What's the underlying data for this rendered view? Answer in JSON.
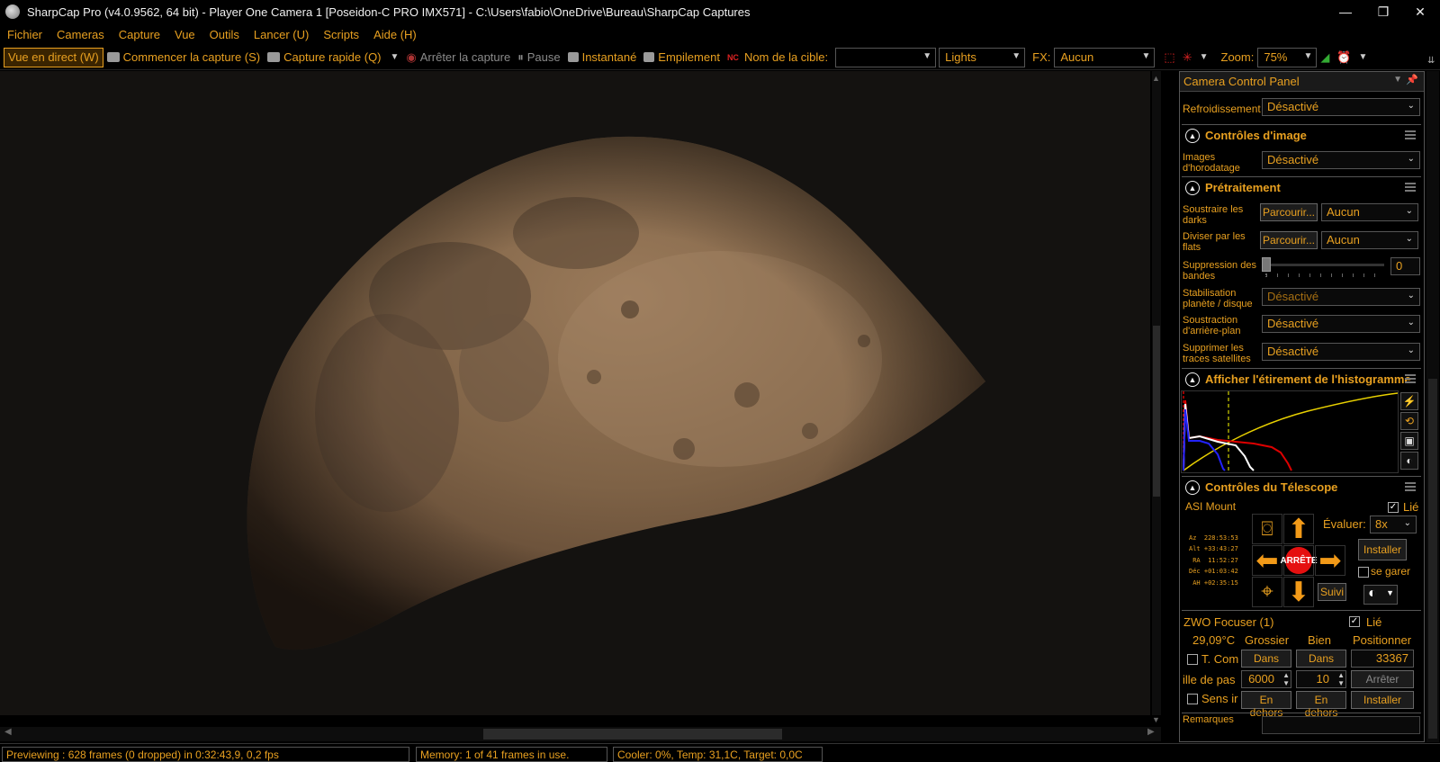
{
  "window": {
    "title": "SharpCap Pro (v4.0.9562, 64 bit) - Player One Camera 1 [Poseidon-C PRO IMX571] - C:\\Users\\fabio\\OneDrive\\Bureau\\SharpCap Captures",
    "minimize": "—",
    "maximize": "❐",
    "close": "✕"
  },
  "menu": [
    "Fichier",
    "Cameras",
    "Capture",
    "Vue",
    "Outils",
    "Lancer (U)",
    "Scripts",
    "Aide (H)"
  ],
  "toolbar": {
    "live": "Vue en direct (W)",
    "start_capture": "Commencer la capture (S)",
    "quick_capture": "Capture rapide (Q)",
    "stop_capture": "Arrêter la capture",
    "pause": "Pause",
    "snapshot": "Instantané",
    "stack": "Empilement",
    "target_label": "Nom de la cible:",
    "target_value": "",
    "frame_type": "Lights",
    "fx_label": "FX:",
    "fx_value": "Aucun",
    "zoom_label": "Zoom:",
    "zoom_value": "75%"
  },
  "panel": {
    "title": "Camera Control Panel",
    "cooling_label": "Refroidissement",
    "cooling_value": "Désactivé",
    "image_controls": {
      "title": "Contrôles d'image",
      "timestamp_label": "Images d'horodatage",
      "timestamp_value": "Désactivé"
    },
    "preprocessing": {
      "title": "Prétraitement",
      "darks_label": "Soustraire les darks",
      "darks_browse": "Parcourir...",
      "darks_value": "Aucun",
      "flats_label": "Diviser par les flats",
      "flats_browse": "Parcourir...",
      "flats_value": "Aucun",
      "banding_label": "Suppression des bandes",
      "banding_value": "0",
      "stab_label": "Stabilisation planète / disque",
      "stab_value": "Désactivé",
      "bg_label": "Soustraction d'arrière-plan",
      "bg_value": "Désactivé",
      "sat_label": "Supprimer les traces satellites",
      "sat_value": "Désactivé"
    },
    "histogram": {
      "title": "Afficher l'étirement de l'histogramme"
    },
    "telescope": {
      "title": "Contrôles du Télescope",
      "mount": "ASI Mount",
      "linked": "Lié",
      "rate_label": "Évaluer:",
      "rate_value": "8x",
      "install": "Installer",
      "stop": "ARRÊTE",
      "park": "se garer",
      "track": "Suivi",
      "coords": [
        "Az  228:53:53",
        "Alt +33:43:27",
        " RA  11:52:27",
        "Déc +01:03:42",
        " AH +02:35:15"
      ]
    },
    "focuser": {
      "title": "ZWO Focuser (1)",
      "linked": "Lié",
      "temp": "29,09°C",
      "coarse": "Grossier",
      "fine": "Bien",
      "position_label": "Positionner",
      "tcomp": "T. Com",
      "in": "Dans",
      "position": "33367",
      "step_label": "ille de pas",
      "coarse_step": "6000",
      "fine_step": "10",
      "stop": "Arrêter",
      "reverse": "Sens ir",
      "out": "En dehors",
      "install": "Installer"
    },
    "notes": "Remarques"
  },
  "status": {
    "preview": "Previewing : 628 frames (0 dropped) in 0:32:43,9, 0,2 fps",
    "memory": "Memory: 1 of 41 frames in use.",
    "cooler": "Cooler: 0%, Temp: 31,1C, Target: 0,0C"
  }
}
